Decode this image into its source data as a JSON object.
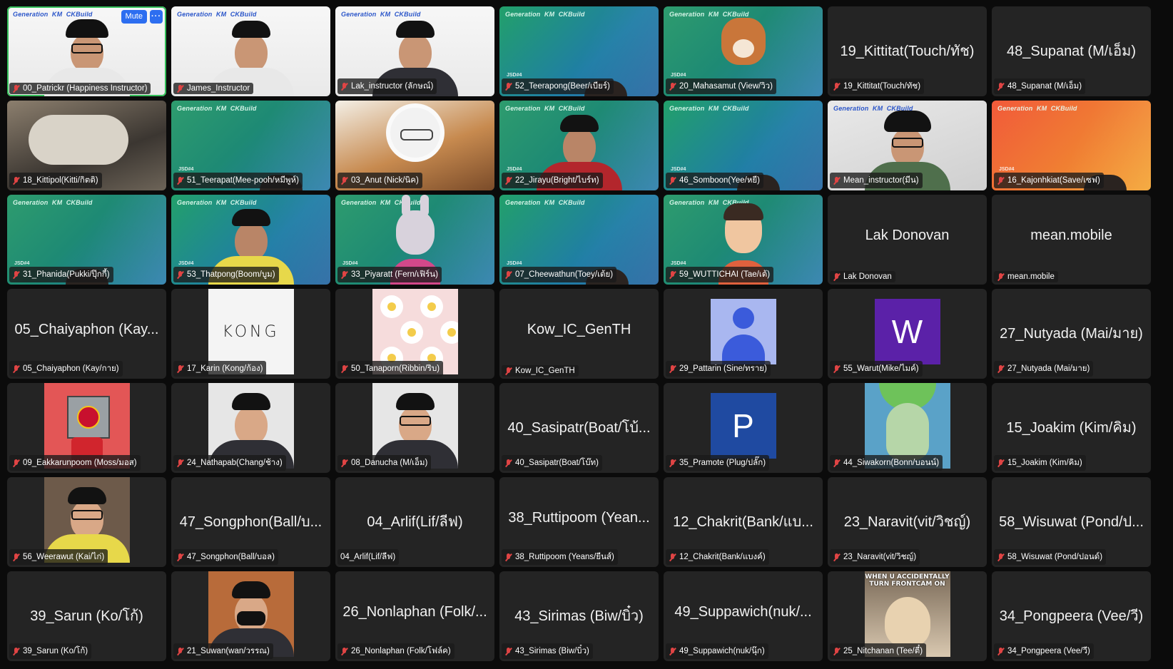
{
  "controls": {
    "mute_label": "Mute",
    "more_label": "···"
  },
  "tiles": [
    {
      "name": "00_Patrickr (Happiness Instructor)",
      "kind": "video-instructor-cap",
      "active": true
    },
    {
      "name": "James_Instructor",
      "kind": "video-instructor",
      "active": false
    },
    {
      "name": "Lak_instructor (ลักษณ์)",
      "kind": "video-instructor-female",
      "active": false
    },
    {
      "name": "52_Teerapong(Beer/เบียร์)",
      "kind": "video-green-partial",
      "active": false
    },
    {
      "name": "20_Mahasamut (View/วิว)",
      "kind": "video-green-dog",
      "active": false
    },
    {
      "name": "19_Kittitat(Touch/ทัช)",
      "display": "19_Kittitat(Touch/ทัช)",
      "kind": "name",
      "active": false
    },
    {
      "name": "48_Supanat (M/เอ็ม)",
      "display": "48_Supanat (M/เอ็ม)",
      "kind": "name",
      "active": false
    },
    {
      "name": "18_Kittipol(Kitti/กิตติ)",
      "kind": "video-cat",
      "active": false
    },
    {
      "name": "51_Teerapat(Mee-pooh/หมีพูห์)",
      "kind": "video-green-partial",
      "active": false
    },
    {
      "name": "03_Anut (Nick/นิค)",
      "kind": "video-food-grandpa",
      "active": false
    },
    {
      "name": "22_Jirayu(Bright/ไบร์ท)",
      "kind": "video-green-person-red",
      "active": false
    },
    {
      "name": "46_Somboon(Yee/หยี)",
      "kind": "video-green-partial",
      "active": false
    },
    {
      "name": "Mean_instructor(มีน)",
      "kind": "video-room-headset",
      "active": false
    },
    {
      "name": "16_Kajonhkiat(Save/เซฟ)",
      "kind": "video-orange-partial",
      "active": false
    },
    {
      "name": "31_Phanida(Pukki/ปุ๊กกี้)",
      "kind": "video-green-partial",
      "active": false
    },
    {
      "name": "53_Thatpong(Boom/บูม)",
      "kind": "video-green-person-yellow",
      "active": false
    },
    {
      "name": "33_Piyaratt (Fern/เฟิร์น)",
      "kind": "video-green-rabbit",
      "active": false
    },
    {
      "name": "07_Cheewathun(Toey/เต้ย)",
      "kind": "video-green-partial",
      "active": false
    },
    {
      "name": "59_WUTTICHAI (Tae/เต้)",
      "kind": "video-green-memoji",
      "active": false
    },
    {
      "name": "Lak Donovan",
      "display": "Lak Donovan",
      "kind": "name",
      "active": false
    },
    {
      "name": "mean.mobile",
      "display": "mean.mobile",
      "kind": "name",
      "active": false
    },
    {
      "name": "05_Chaiyaphon (Kay/กาย)",
      "display": "05_Chaiyaphon (Kay...",
      "kind": "name",
      "active": false
    },
    {
      "name": "17_Karin (Kong/ก้อง)",
      "kind": "pic-kong",
      "pic_text": "KONG",
      "active": false
    },
    {
      "name": "50_Tanaporn(Ribbin/ริบ)",
      "kind": "pic-flowers",
      "active": false
    },
    {
      "name": "Kow_IC_GenTH",
      "display": "Kow_IC_GenTH",
      "kind": "name",
      "active": false
    },
    {
      "name": "29_Pattarin (Sine/ทราย)",
      "kind": "pic-default",
      "active": false
    },
    {
      "name": "55_Warut(Mike/ไมค์)",
      "kind": "pic-letter",
      "letter": "W",
      "letter_color": "#5b21a8",
      "active": false
    },
    {
      "name": "27_Nutyada (Mai/มาย)",
      "display": "27_Nutyada (Mai/มาย)",
      "kind": "name",
      "active": false
    },
    {
      "name": "09_Eakkarunpoom (Moss/มอส)",
      "kind": "pic-mu",
      "active": false
    },
    {
      "name": "24_Nathapab(Chang/ช้าง)",
      "kind": "pic-photo",
      "active": false
    },
    {
      "name": "08_Danucha (M/เอ็ม)",
      "kind": "pic-photo-glasses",
      "active": false
    },
    {
      "name": "40_Sasipatr(Boat/โบ๊ท)",
      "display": "40_Sasipatr(Boat/โบ้...",
      "kind": "name",
      "active": false
    },
    {
      "name": "35_Pramote (Plug/ปลั๊ก)",
      "kind": "pic-letter",
      "letter": "P",
      "letter_color": "#1f4aa1",
      "active": false
    },
    {
      "name": "44_Siwakorn(Bonn/บอนน์)",
      "kind": "pic-squid",
      "active": false
    },
    {
      "name": "15_Joakim (Kim/คิม)",
      "display": "15_Joakim (Kim/คิม)",
      "kind": "name",
      "active": false
    },
    {
      "name": "56_Weerawut (Kai/ไก่)",
      "kind": "pic-photo-yellow",
      "active": false
    },
    {
      "name": "47_Songphon(Ball/บอล)",
      "display": "47_Songphon(Ball/บ...",
      "kind": "name",
      "active": false
    },
    {
      "name": "04_Arlif(Lif/ลีฟ)",
      "display": "04_Arlif(Lif/ลีฟ)",
      "kind": "name",
      "muted": false,
      "active": false
    },
    {
      "name": "38_Ruttipoom (Yeans/ยีนส์)",
      "display": "38_Ruttipoom (Yean...",
      "kind": "name",
      "active": false
    },
    {
      "name": "12_Chakrit(Bank/แบงค์)",
      "display": "12_Chakrit(Bank/แบ...",
      "kind": "name",
      "active": false
    },
    {
      "name": "23_Naravit(vit/วิชญ์)",
      "display": "23_Naravit(vit/วิชญ์)",
      "kind": "name",
      "active": false
    },
    {
      "name": "58_Wisuwat (Pond/ปอนด์)",
      "display": "58_Wisuwat (Pond/ป...",
      "kind": "name",
      "active": false
    },
    {
      "name": "39_Sarun (Ko/โก้)",
      "display": "39_Sarun (Ko/โก้)",
      "kind": "name",
      "active": false
    },
    {
      "name": "21_Suwan(wan/วรรณ)",
      "kind": "pic-photo-mask",
      "active": false
    },
    {
      "name": "26_Nonlaphan (Folk/โฟล์ค)",
      "display": "26_Nonlaphan (Folk/...",
      "kind": "name",
      "active": false
    },
    {
      "name": "43_Sirimas (Biw/บิ๋ว)",
      "display": "43_Sirimas (Biw/บิ๋ว)",
      "kind": "name",
      "active": false
    },
    {
      "name": "49_Suppawich(nuk/นุ๊ก)",
      "display": "49_Suppawich(nuk/...",
      "kind": "name",
      "active": false
    },
    {
      "name": "25_Nitchanan (Tee/ตี๋)",
      "kind": "pic-meme",
      "caption": "WHEN U ACCIDENTALLY TURN FRONTCAM ON",
      "active": false
    },
    {
      "name": "34_Pongpeera (Vee/วี)",
      "display": "34_Pongpeera (Vee/วี)",
      "kind": "name",
      "active": false
    }
  ]
}
